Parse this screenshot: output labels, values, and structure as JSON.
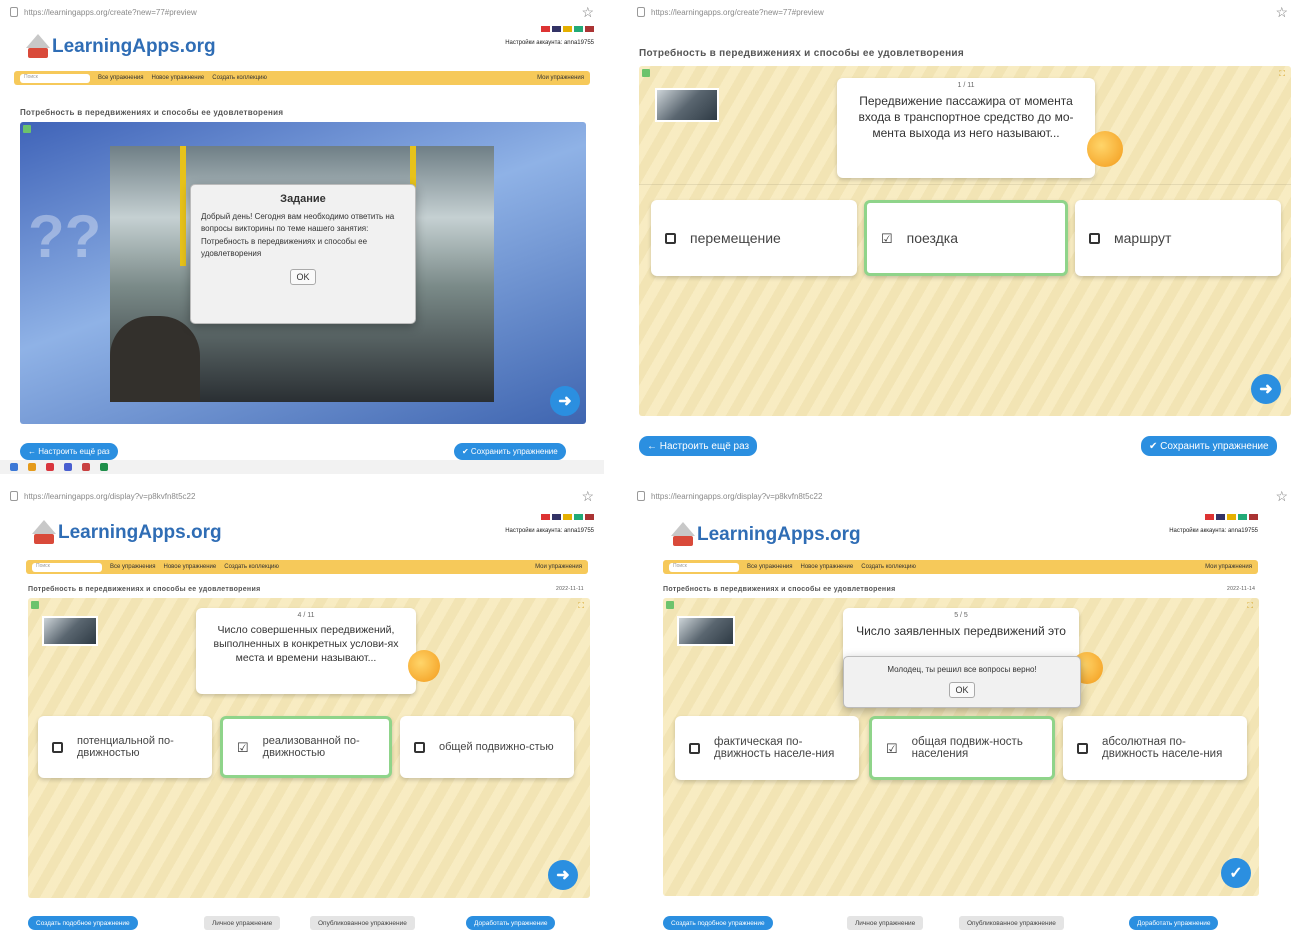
{
  "colors": {
    "accent": "#2b8fe0",
    "nav": "#f6c95a",
    "stage": "#f7e9b8",
    "selected_border": "#8fd48a"
  },
  "q1": {
    "url": "https://learningapps.org/create?new=77#preview",
    "logo": "LearningApps.org",
    "account": "Настройки аккаунта: anna19755",
    "nav": {
      "search": "Поиск",
      "all": "Все упражнения",
      "new": "Новое упражнение",
      "collection": "Создать коллекцию",
      "mine": "Мои упражнения"
    },
    "title": "Потребность в передвижениях и способы ее удовлетворения",
    "modal": {
      "heading": "Задание",
      "body": "Добрый день! Сегодня вам необходимо ответить на вопросы викторины по теме нашего занятия: Потребность в передвижениях и способы ее удовлетворения",
      "ok": "OK"
    },
    "btn_left": "← Настроить ещё раз",
    "btn_right": "✔ Сохранить упражнение"
  },
  "q2": {
    "url": "https://learningapps.org/create?new=77#preview",
    "title": "Потребность в передвижениях и способы ее удовлетворения",
    "counter": "1 / 11",
    "question": "Передвижение пассажира от момента входа в транспортное средство до мо-мента выхода из него называют...",
    "answers": [
      "перемещение",
      "поездка",
      "маршрут"
    ],
    "selected": 1,
    "btn_left": "← Настроить ещё раз",
    "btn_right": "✔ Сохранить упражнение"
  },
  "q3": {
    "url": "https://learningapps.org/display?v=p8kvfn8t5c22",
    "logo": "LearningApps.org",
    "account": "Настройки аккаунта: anna19755",
    "nav": {
      "search": "Поиск",
      "all": "Все упражнения",
      "new": "Новое упражнение",
      "collection": "Создать коллекцию",
      "mine": "Мои упражнения"
    },
    "title": "Потребность в передвижениях и способы ее удовлетворения",
    "date": "2022-11-11",
    "counter": "4 / 11",
    "question": "Число совершенных передвижений, выполненных в конкретных услови-ях места и времени называют...",
    "answers": [
      "потенциальной по-движностью",
      "реализованной по-движностью",
      "общей подвижно-стью"
    ],
    "selected": 1,
    "footer": {
      "similar": "Создать подобное упражнение",
      "private": "Личное упражнение",
      "public": "Опубликованное упражнение",
      "edit": "Доработать упражнение"
    }
  },
  "q4": {
    "url": "https://learningapps.org/display?v=p8kvfn8t5c22",
    "logo": "LearningApps.org",
    "account": "Настройки аккаунта: anna19755",
    "nav": {
      "search": "Поиск",
      "all": "Все упражнения",
      "new": "Новое упражнение",
      "collection": "Создать коллекцию",
      "mine": "Мои упражнения"
    },
    "title": "Потребность в передвижениях и способы ее удовлетворения",
    "date": "2022-11-14",
    "counter": "5 / 5",
    "question": "Число заявленных передвижений это",
    "modal": {
      "text": "Молодец, ты решил все вопросы верно!",
      "ok": "OK"
    },
    "answers": [
      "фактическая по-движность населе-ния",
      "общая подвиж-ность населения",
      "абсолютная по-движность населе-ния"
    ],
    "selected": 1,
    "footer": {
      "similar": "Создать подобное упражнение",
      "private": "Личное упражнение",
      "public": "Опубликованное упражнение",
      "edit": "Доработать упражнение"
    }
  }
}
